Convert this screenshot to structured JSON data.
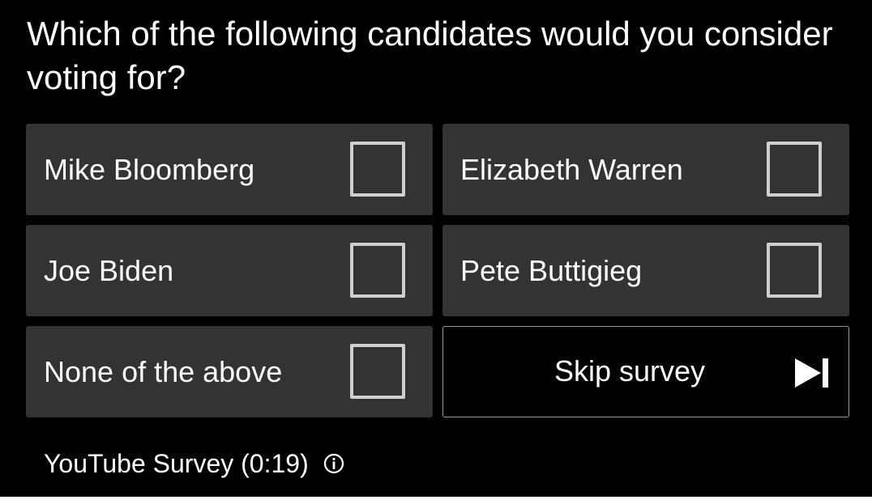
{
  "survey": {
    "question": "Which of the following candidates would you consider voting for?",
    "options": [
      {
        "label": "Mike Bloomberg",
        "checked": false
      },
      {
        "label": "Elizabeth Warren",
        "checked": false
      },
      {
        "label": "Joe Biden",
        "checked": false
      },
      {
        "label": "Pete Buttigieg",
        "checked": false
      },
      {
        "label": "None of the above",
        "checked": false
      }
    ],
    "skip_label": "Skip survey",
    "skip_icon": "skip-next-icon",
    "footer_text": "YouTube Survey (0:19)",
    "info_icon": "info-icon"
  },
  "colors": {
    "background": "#000000",
    "option_background": "#333333",
    "checkbox_border": "#cfcfcf",
    "text": "#ffffff",
    "skip_border": "#9a9a9a"
  }
}
